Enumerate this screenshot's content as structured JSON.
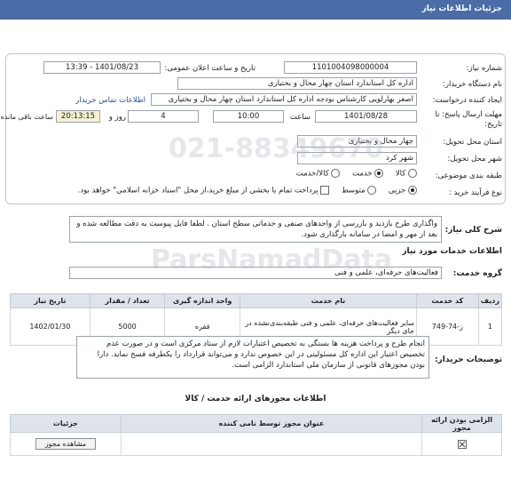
{
  "header": {
    "title": "جزئیات اطلاعات نیاز"
  },
  "form": {
    "need_number_label": "شماره نیاز:",
    "need_number": "1101004098000004",
    "announce_label": "تاریخ و ساعت اعلان عمومی:",
    "announce_value": "1401/08/23 - 13:39",
    "buyer_label": "نام دستگاه خریدار:",
    "buyer_value": "اداره کل استاندارد استان چهار محال و بختیاری",
    "creator_label": "ایجاد کننده درخواست:",
    "creator_value": "اصغر بهارلویی  کارشناس بودجه اداره کل استاندارد استان چهار محال و بختیاری",
    "contact_link": "اطلاعات تماس خریدار",
    "deadline_label": "مهلت ارسال پاسخ: تا",
    "deadline_label2": "تاریخ:",
    "deadline_date": "1401/08/28",
    "time_label": "ساعت",
    "time_value": "10:00",
    "days_value": "4",
    "days_label": "روز و",
    "remaining_value": "20:13:15",
    "remaining_label": "ساعت باقی مانده",
    "province_label": "استان محل تحویل:",
    "province_value": "چهار محال و بختیاری",
    "city_label": "شهر محل تحویل:",
    "city_value": "شهر کرد",
    "category_label": "طبقه بندی موضوعی:",
    "category_options": [
      "کالا",
      "خدمت",
      "کالا/خدمت"
    ],
    "category_selected": "خدمت",
    "process_label": "نوع فرآیند خرید :",
    "process_options": [
      "جزیی",
      "متوسط"
    ],
    "process_selected": "جزیی",
    "payment_note": "پرداخت تمام یا بخشی از مبلغ خرید،از محل \"اسناد خزانه اسلامی\" خواهد بود."
  },
  "description": {
    "label": "شرح کلی نیاز:",
    "text": "واگذاری طرح بازدید و بازرسی از واحدهای صنفی و خدماتی سطح استان . لطفا فایل پیوست به دقت مطالعه شده و بعد از مهر و امضا در سامانه بارگذاری شود."
  },
  "services": {
    "title": "اطلاعات خدمات مورد نیاز",
    "group_label": "گروه خدمت:",
    "group_value": "فعالیت‌های حرفه‌ای، علمی و فنی",
    "table_headers": [
      "ردیف",
      "کد خدمت",
      "نام خدمت",
      "واحد اندازه گیری",
      "تعداد / مقدار",
      "تاریخ نیاز"
    ],
    "rows": [
      {
        "row": "1",
        "code": "ز-74-749",
        "name": "سایر فعالیت‌های حرفه‌ای، علمی و فنی طبقه‌بندی‌نشده در جای دیگر",
        "unit": "فقره",
        "qty": "5000",
        "date": "1402/01/30"
      }
    ]
  },
  "buyer_notes": {
    "label": "توضیحات خریدار:",
    "text": "انجام طرح و پرداخت هزینه ها بستگی به تخصیص اعتبارات لازم از ستاد مرکزی است و در صورت عدم تخصیص اعتبار این اداره کل مسئولیتی در این خصوص ندارد و می‌تواند قرارداد را یکطرفه فسخ نماید. دارا بودن مجوزهای قانونی از سازمان ملی استاندارد الزامی است."
  },
  "permits": {
    "title": "اطلاعات مجوزهای ارائه خدمت / کالا",
    "headers": [
      "الزامی بودن ارائه مجوز",
      "عنوان مجوز توسط نامی کننده",
      "جزئیات"
    ],
    "view_button": "مشاهده مجوز"
  },
  "watermark": {
    "brand": "ParsNamadData",
    "phone": "021-88349670"
  }
}
